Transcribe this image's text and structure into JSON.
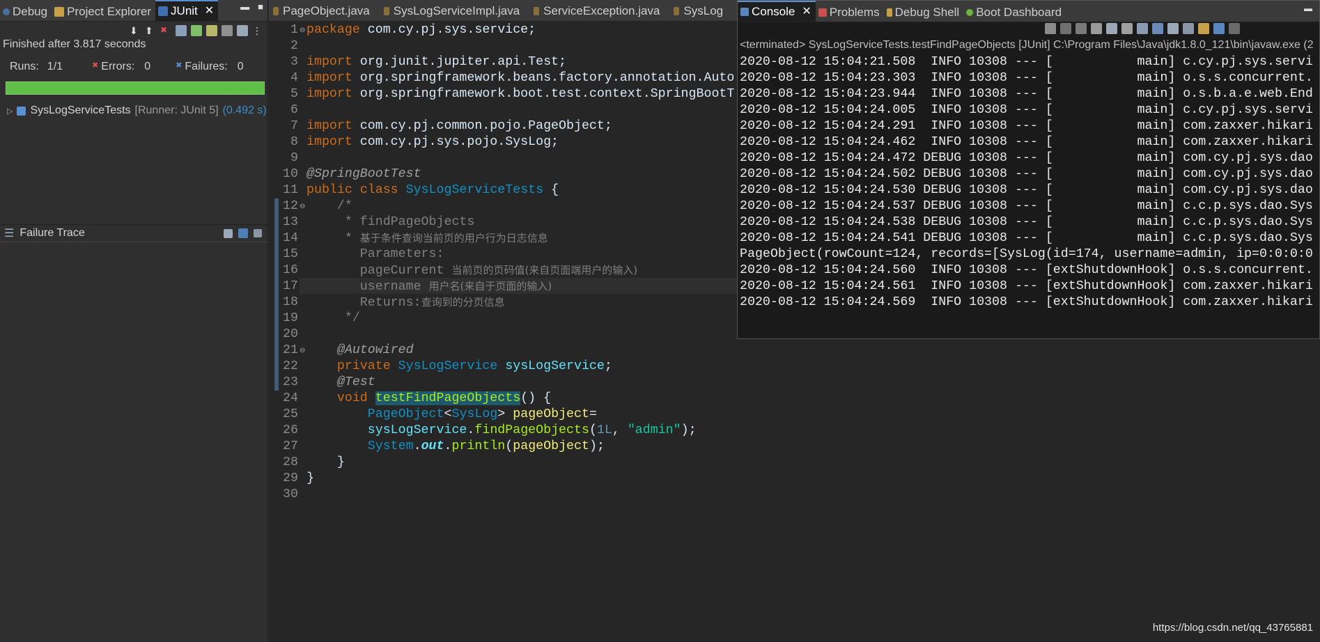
{
  "left": {
    "tabs": [
      "Debug",
      "Project Explorer",
      "JUnit"
    ],
    "finished": "Finished after 3.817 seconds",
    "runs_label": "Runs:",
    "runs_value": "1/1",
    "errors_label": "Errors:",
    "errors_value": "0",
    "failures_label": "Failures:",
    "failures_value": "0",
    "test_name": "SysLogServiceTests",
    "test_runner": "[Runner: JUnit 5]",
    "test_time": "(0.492 s)",
    "failure_trace": "Failure Trace"
  },
  "editor": {
    "tabs": [
      "PageObject.java",
      "SysLogServiceImpl.java",
      "ServiceException.java",
      "SysLog"
    ],
    "line_numbers": [
      "1",
      "2",
      "3",
      "4",
      "5",
      "6",
      "7",
      "8",
      "9",
      "10",
      "11",
      "12",
      "13",
      "14",
      "15",
      "16",
      "17",
      "18",
      "19",
      "20",
      "21",
      "22",
      "23",
      "24",
      "25",
      "26",
      "27",
      "28",
      "29",
      "30"
    ],
    "code": {
      "l1_kw": "package",
      "l1_rest": " com.cy.pj.sys.service;",
      "l3_kw": "import",
      "l3_rest": " org.junit.jupiter.api.Test;",
      "l4_kw": "import",
      "l4_rest": " org.springframework.beans.factory.annotation.Auto",
      "l5_kw": "import",
      "l5_rest": " org.springframework.boot.test.context.SpringBootT",
      "l7_kw": "import",
      "l7_rest": " com.cy.pj.common.pojo.PageObject;",
      "l8_kw": "import",
      "l8_rest": " com.cy.pj.sys.pojo.SysLog;",
      "l10": "@SpringBootTest",
      "l11_kw": "public class",
      "l11_cls": "SysLogServiceTests",
      "l11_rest": " {",
      "l12": "    /*",
      "l13": "     * findPageObjects",
      "l14_star": "     * ",
      "l14_zh": "基于条件查询当前页的用户行为日志信息",
      "l15": "       Parameters:",
      "l16_a": "       pageCurrent ",
      "l16_zh": "当前页的页码值(来自页面端用户的输入)",
      "l17_a": "       username ",
      "l17_zh": "用户名(来自于页面的输入)",
      "l18_a": "       Returns:",
      "l18_zh": "查询到的分页信息",
      "l19": "     */",
      "l21": "    @Autowired",
      "l22_kw": "    private ",
      "l22_cls": "SysLogService",
      "l22_var": " sysLogService",
      "l22_end": ";",
      "l23": "    @Test",
      "l24_kw": "    void ",
      "l24_m": "testFindPageObjects",
      "l24_end": "() {",
      "l25_a": "        ",
      "l25_cls": "PageObject",
      "l25_b": "<",
      "l25_cls2": "SysLog",
      "l25_c": "> ",
      "l25_var": "pageObject",
      "l25_d": "=",
      "l26_a": "        ",
      "l26_var": "sysLogService",
      "l26_b": ".",
      "l26_m": "findPageObjects",
      "l26_c": "(",
      "l26_num": "1L",
      "l26_d": ", ",
      "l26_str": "\"admin\"",
      "l26_e": ");",
      "l27_a": "        ",
      "l27_cls": "System",
      "l27_b": ".",
      "l27_out": "out",
      "l27_c": ".",
      "l27_m": "println",
      "l27_d": "(",
      "l27_var": "pageObject",
      "l27_e": ");",
      "l28": "    }",
      "l29": "}"
    }
  },
  "console": {
    "tabs": [
      "Console",
      "Problems",
      "Debug Shell",
      "Boot Dashboard"
    ],
    "terminated": "<terminated> SysLogServiceTests.testFindPageObjects [JUnit] C:\\Program Files\\Java\\jdk1.8.0_121\\bin\\javaw.exe  (2",
    "lines": [
      "2020-08-12 15:04:21.508  INFO 10308 --- [           main] c.cy.pj.sys.servi",
      "2020-08-12 15:04:23.303  INFO 10308 --- [           main] o.s.s.concurrent.",
      "2020-08-12 15:04:23.944  INFO 10308 --- [           main] o.s.b.a.e.web.End",
      "2020-08-12 15:04:24.005  INFO 10308 --- [           main] c.cy.pj.sys.servi",
      "2020-08-12 15:04:24.291  INFO 10308 --- [           main] com.zaxxer.hikari",
      "2020-08-12 15:04:24.462  INFO 10308 --- [           main] com.zaxxer.hikari",
      "2020-08-12 15:04:24.472 DEBUG 10308 --- [           main] com.cy.pj.sys.dao",
      "2020-08-12 15:04:24.502 DEBUG 10308 --- [           main] com.cy.pj.sys.dao",
      "2020-08-12 15:04:24.530 DEBUG 10308 --- [           main] com.cy.pj.sys.dao",
      "2020-08-12 15:04:24.537 DEBUG 10308 --- [           main] c.c.p.sys.dao.Sys",
      "2020-08-12 15:04:24.538 DEBUG 10308 --- [           main] c.c.p.sys.dao.Sys",
      "2020-08-12 15:04:24.541 DEBUG 10308 --- [           main] c.c.p.sys.dao.Sys",
      "PageObject(rowCount=124, records=[SysLog(id=174, username=admin, ip=0:0:0:0",
      "2020-08-12 15:04:24.560  INFO 10308 --- [extShutdownHook] o.s.s.concurrent.",
      "2020-08-12 15:04:24.561  INFO 10308 --- [extShutdownHook] com.zaxxer.hikari",
      "2020-08-12 15:04:24.569  INFO 10308 --- [extShutdownHook] com.zaxxer.hikari"
    ]
  },
  "watermark": "https://blog.csdn.net/qq_43765881"
}
